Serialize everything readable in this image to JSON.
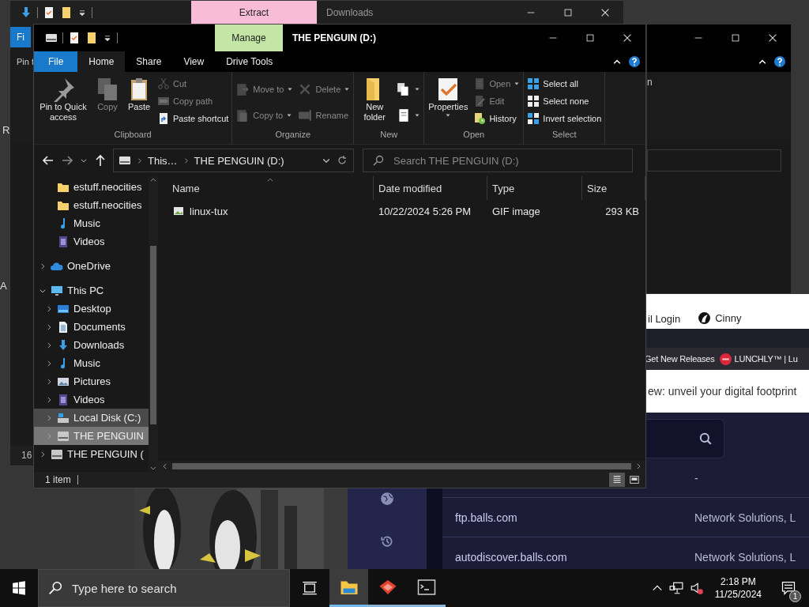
{
  "desktop": {
    "label_fragments": [
      "R",
      "A"
    ],
    "picture": {
      "kind": "picture"
    }
  },
  "back_window": {
    "context_tab": "Extract",
    "title": "Downloads",
    "file_tab": "Fi",
    "ribbon_fragment": "Pin t",
    "status_fragment": "16"
  },
  "side_window": {
    "ribbon_fragment": "n"
  },
  "browser": {
    "bookmarks": [
      {
        "label": "il Login",
        "kind": "plain"
      },
      {
        "label": "Cinny",
        "kind": "feather"
      }
    ],
    "bookmarks_2": [
      {
        "label": "Get New Releases",
        "kind": "plain"
      },
      {
        "label": "LUNCHLY™ | Lu",
        "kind": "disc"
      }
    ],
    "banner": "ew: unveil your digital footprint",
    "rows": [
      {
        "host": "",
        "org": "-"
      },
      {
        "host": "ftp.balls.com",
        "org": "Network Solutions, L"
      },
      {
        "host": "autodiscover.balls.com",
        "org": "Network Solutions, L"
      }
    ]
  },
  "explorer": {
    "context_tab": "Manage",
    "title": "THE PENGUIN (D:)",
    "tabs": [
      {
        "label": "File",
        "kind": "file",
        "selected": false
      },
      {
        "label": "Home",
        "kind": "tab",
        "selected": true
      },
      {
        "label": "Share",
        "kind": "tab",
        "selected": false
      },
      {
        "label": "View",
        "kind": "tab",
        "selected": false
      },
      {
        "label": "Drive Tools",
        "kind": "tab",
        "selected": false
      }
    ],
    "ribbon_groups": [
      {
        "label": "Clipboard",
        "columns": [
          [
            {
              "label": "Pin to Quick access",
              "kind": "pin",
              "disabled": false,
              "dropdown": false
            }
          ],
          [
            {
              "label": "Copy",
              "kind": "copy",
              "disabled": true,
              "dropdown": false
            }
          ],
          [
            {
              "label": "Paste",
              "kind": "paste",
              "disabled": false,
              "dropdown": false
            }
          ],
          [
            {
              "label": "Cut",
              "kind": "cut",
              "disabled": true,
              "dropdown": false
            },
            {
              "label": "Copy path",
              "kind": "path",
              "disabled": true,
              "dropdown": false
            },
            {
              "label": "Paste shortcut",
              "kind": "shortcut",
              "disabled": false,
              "dropdown": false
            }
          ]
        ]
      },
      {
        "label": "Organize",
        "columns": [
          [
            {
              "label": "Move to",
              "kind": "move",
              "disabled": true,
              "dropdown": true
            },
            {
              "label": "Copy to",
              "kind": "duplicate",
              "disabled": true,
              "dropdown": true
            }
          ],
          [
            {
              "label": "Delete",
              "kind": "delete",
              "disabled": true,
              "dropdown": true
            },
            {
              "label": "Rename",
              "kind": "rename",
              "disabled": true,
              "dropdown": false
            }
          ]
        ]
      },
      {
        "label": "New",
        "columns": [
          [
            {
              "label": "New folder",
              "kind": "folder",
              "disabled": false,
              "dropdown": false
            }
          ],
          [
            {
              "kind": "newitem",
              "disabled": false,
              "dropdown": true
            },
            {
              "kind": "access",
              "disabled": false,
              "dropdown": true
            }
          ]
        ]
      },
      {
        "label": "Open",
        "columns": [
          [
            {
              "label": "Properties",
              "kind": "properties",
              "disabled": false,
              "dropdown": true
            }
          ],
          [
            {
              "label": "Open",
              "kind": "open",
              "disabled": true,
              "dropdown": true
            },
            {
              "label": "Edit",
              "kind": "edit",
              "disabled": true,
              "dropdown": false
            },
            {
              "label": "History",
              "kind": "history",
              "disabled": false,
              "dropdown": false
            }
          ]
        ]
      },
      {
        "label": "Select",
        "columns": [
          [
            {
              "label": "Select all",
              "kind": "all",
              "disabled": false,
              "dropdown": false
            },
            {
              "label": "Select none",
              "kind": "none",
              "disabled": false,
              "dropdown": false
            },
            {
              "label": "Invert selection",
              "kind": "invert",
              "disabled": false,
              "dropdown": false
            }
          ]
        ]
      }
    ],
    "address": {
      "crumbs": [
        "This…",
        "THE PENGUIN (D:)"
      ]
    },
    "search": {
      "placeholder": "Search THE PENGUIN (D:)"
    },
    "nav_tree": [
      {
        "kind": "scrolled",
        "children": [
          {
            "label": "estuff.neocities",
            "kind": "folder",
            "selected": false,
            "hovered": false
          },
          {
            "label": "estuff.neocities",
            "kind": "folder",
            "selected": false,
            "hovered": false
          },
          {
            "label": "Music",
            "kind": "music",
            "selected": false,
            "hovered": false
          },
          {
            "label": "Videos",
            "kind": "video",
            "selected": false,
            "hovered": false
          }
        ]
      },
      {
        "label": "OneDrive",
        "kind": "cloud",
        "expanded": false,
        "selected": false,
        "hovered": false
      },
      {
        "label": "This PC",
        "kind": "computer",
        "expanded": true,
        "selected": false,
        "hovered": false,
        "children": [
          {
            "label": "Desktop",
            "kind": "desktop",
            "expanded": false,
            "selected": false,
            "hovered": false
          },
          {
            "label": "Documents",
            "kind": "documents",
            "expanded": false,
            "selected": false,
            "hovered": false
          },
          {
            "label": "Downloads",
            "kind": "downloads",
            "expanded": false,
            "selected": false,
            "hovered": false
          },
          {
            "label": "Music",
            "kind": "music",
            "expanded": false,
            "selected": false,
            "hovered": false
          },
          {
            "label": "Pictures",
            "kind": "pictures",
            "expanded": false,
            "selected": false,
            "hovered": false
          },
          {
            "label": "Videos",
            "kind": "video",
            "expanded": false,
            "selected": false,
            "hovered": false
          },
          {
            "label": "Local Disk (C:)",
            "kind": "disk",
            "expanded": false,
            "selected": false,
            "hovered": true
          },
          {
            "label": "THE PENGUIN",
            "kind": "usb",
            "expanded": false,
            "selected": true,
            "hovered": false
          }
        ]
      },
      {
        "label": "THE PENGUIN (",
        "kind": "usb",
        "expanded": false,
        "selected": false,
        "hovered": false
      }
    ],
    "columns": [
      "Name",
      "Date modified",
      "Type",
      "Size"
    ],
    "files": [
      {
        "name": "linux-tux",
        "date_modified": "10/22/2024 5:26 PM",
        "type": "GIF image",
        "size": "293 KB",
        "selected": false
      }
    ],
    "status": "1 item",
    "views": [
      {
        "kind": "details",
        "selected": true
      },
      {
        "kind": "large",
        "selected": false
      }
    ]
  },
  "taskbar": {
    "search_placeholder": "Type here to search",
    "apps": [
      {
        "kind": "explorer",
        "selected": true
      },
      {
        "kind": "diamond",
        "selected": false
      },
      {
        "kind": "terminal",
        "selected": false
      }
    ],
    "time": "2:18 PM",
    "date": "11/25/2024",
    "notifications": "1"
  }
}
